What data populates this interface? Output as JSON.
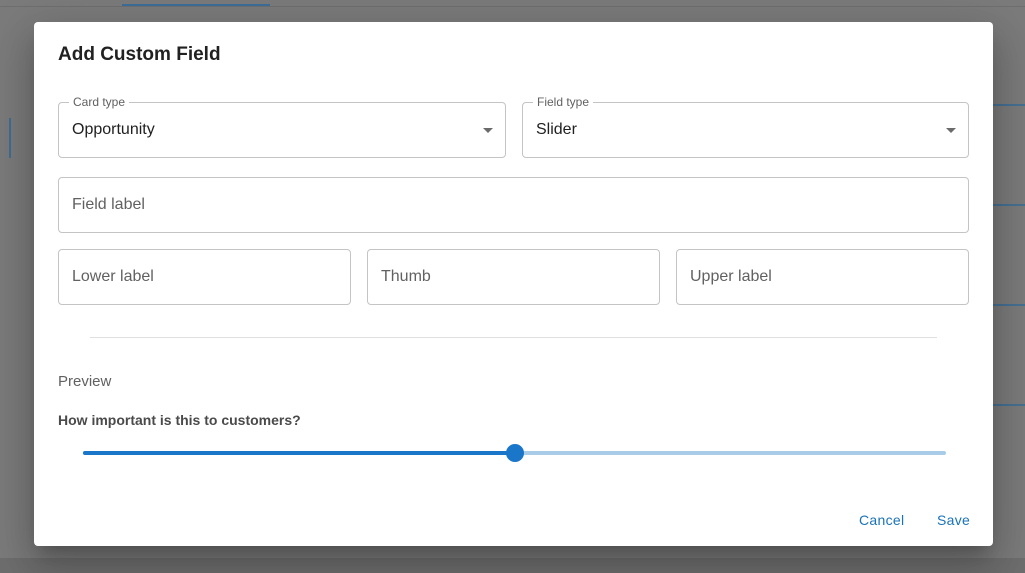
{
  "dialog": {
    "title": "Add Custom Field",
    "card_type": {
      "label": "Card type",
      "value": "Opportunity"
    },
    "field_type": {
      "label": "Field type",
      "value": "Slider"
    },
    "field_label": {
      "placeholder": "Field label"
    },
    "lower_label": {
      "placeholder": "Lower label"
    },
    "thumb": {
      "placeholder": "Thumb"
    },
    "upper_label": {
      "placeholder": "Upper label"
    },
    "preview": {
      "label": "Preview",
      "question": "How important is this to customers?",
      "slider_value_percent": 50
    },
    "actions": {
      "cancel": "Cancel",
      "save": "Save"
    }
  },
  "colors": {
    "accent": "#1976c8",
    "rail": "#a9cde9",
    "overlay": "#7b7b7b"
  }
}
